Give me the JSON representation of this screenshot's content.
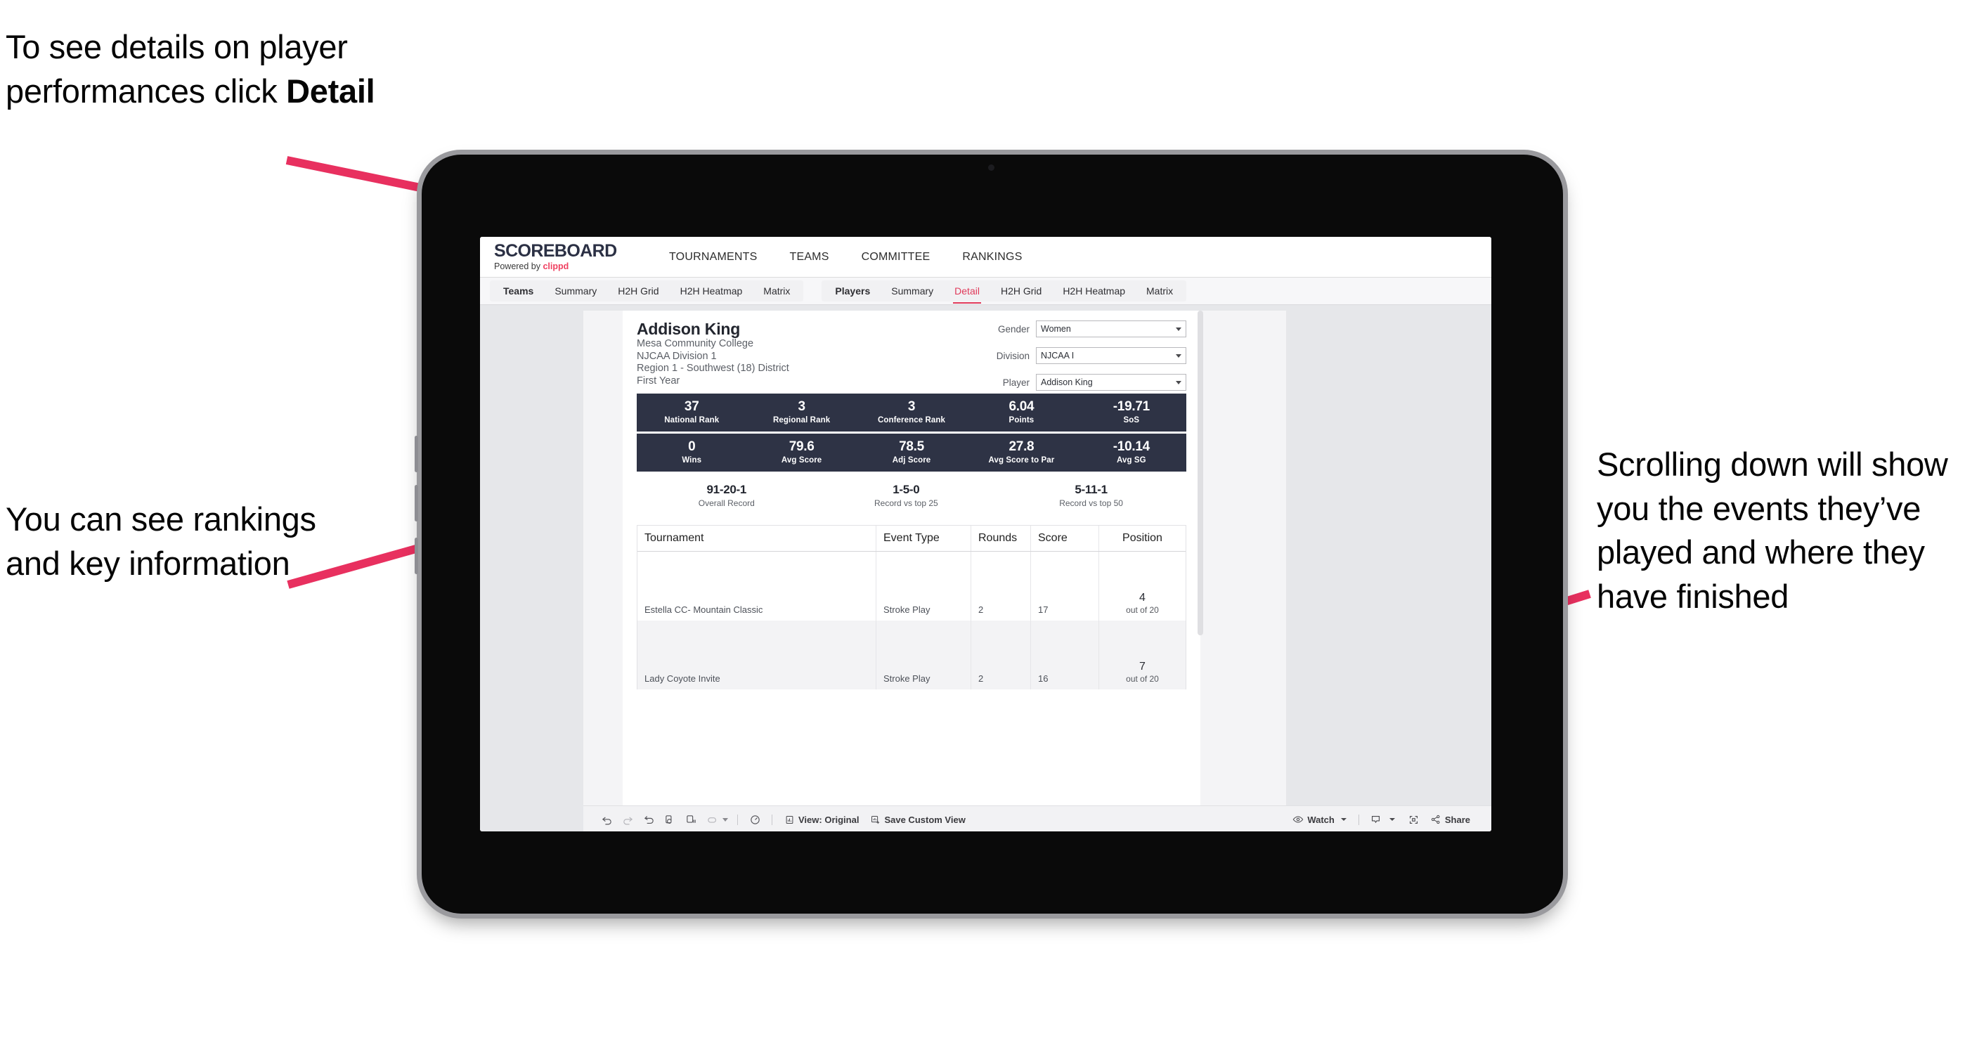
{
  "annotations": {
    "detail_hint": "To see details on player performances click ",
    "detail_hint_bold": "Detail",
    "rankings_hint": "You can see rankings and key information",
    "scroll_hint": "Scrolling down will show you the events they’ve played and where they have finished",
    "arrow_color": "#e8305f"
  },
  "app": {
    "brand": {
      "title": "SCOREBOARD",
      "powered_prefix": "Powered by ",
      "powered_brand": "clippd"
    },
    "top_nav": [
      "TOURNAMENTS",
      "TEAMS",
      "COMMITTEE",
      "RANKINGS"
    ],
    "tab_groups": [
      {
        "head": "Teams",
        "tabs": [
          "Summary",
          "H2H Grid",
          "H2H Heatmap",
          "Matrix"
        ],
        "active": null
      },
      {
        "head": "Players",
        "tabs": [
          "Summary",
          "Detail",
          "H2H Grid",
          "H2H Heatmap",
          "Matrix"
        ],
        "active": "Detail"
      }
    ]
  },
  "player": {
    "name": "Addison King",
    "meta": [
      "Mesa Community College",
      "NJCAA Division 1",
      "Region 1 - Southwest (18) District",
      "First Year"
    ]
  },
  "filters": [
    {
      "label": "Gender",
      "value": "Women"
    },
    {
      "label": "Division",
      "value": "NJCAA I"
    },
    {
      "label": "Player",
      "value": "Addison King"
    }
  ],
  "stat_bands": [
    [
      {
        "value": "37",
        "label": "National Rank"
      },
      {
        "value": "3",
        "label": "Regional Rank"
      },
      {
        "value": "3",
        "label": "Conference Rank"
      },
      {
        "value": "6.04",
        "label": "Points"
      },
      {
        "value": "-19.71",
        "label": "SoS"
      }
    ],
    [
      {
        "value": "0",
        "label": "Wins"
      },
      {
        "value": "79.6",
        "label": "Avg Score"
      },
      {
        "value": "78.5",
        "label": "Adj Score"
      },
      {
        "value": "27.8",
        "label": "Avg Score to Par"
      },
      {
        "value": "-10.14",
        "label": "Avg SG"
      }
    ]
  ],
  "records": [
    {
      "value": "91-20-1",
      "label": "Overall Record"
    },
    {
      "value": "1-5-0",
      "label": "Record vs top 25"
    },
    {
      "value": "5-11-1",
      "label": "Record vs top 50"
    }
  ],
  "table": {
    "columns": [
      "Tournament",
      "Event Type",
      "Rounds",
      "Score",
      "Position"
    ],
    "rows": [
      {
        "tournament": "Estella CC- Mountain Classic",
        "event_type": "Stroke Play",
        "rounds": "2",
        "score": "17",
        "position_rank": "4",
        "position_of": "out of 20"
      },
      {
        "tournament": "Lady Coyote Invite",
        "event_type": "Stroke Play",
        "rounds": "2",
        "score": "16",
        "position_rank": "7",
        "position_of": "out of 20"
      }
    ]
  },
  "toolbar": {
    "view_label": "View: Original",
    "save_label": "Save Custom View",
    "watch_label": "Watch",
    "share_label": "Share"
  },
  "colors": {
    "accent_pink": "#e8305f",
    "brand_red": "#ef4060",
    "band_navy": "#2e3345",
    "active_tab": "#e03a5a"
  }
}
